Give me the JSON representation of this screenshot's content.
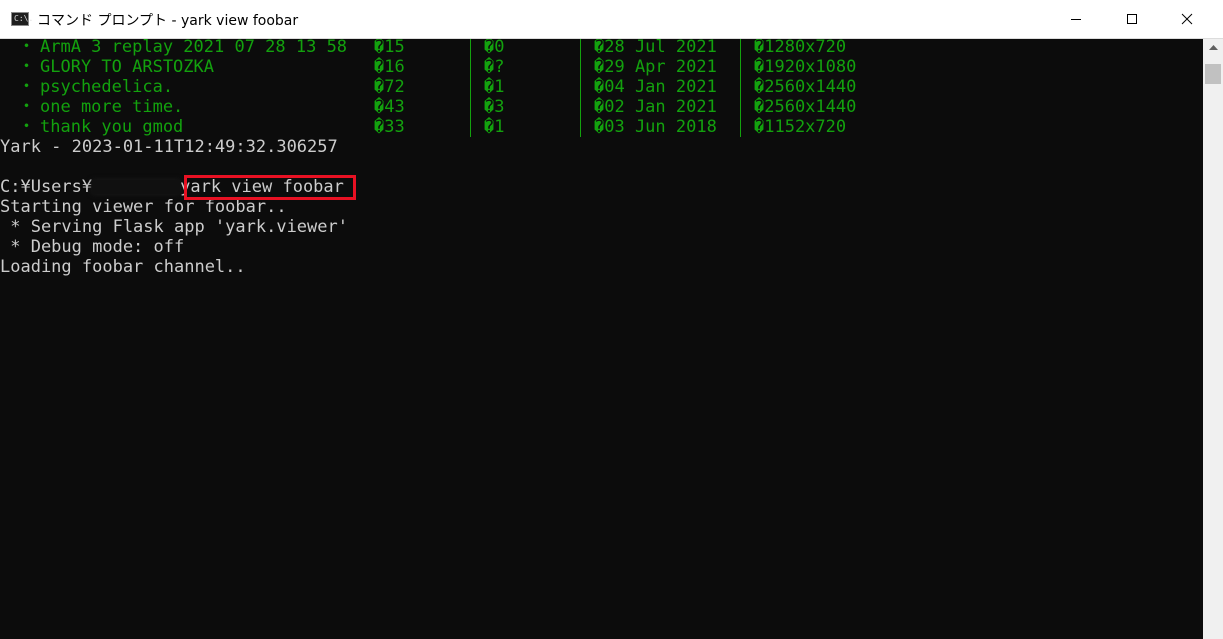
{
  "window": {
    "title": "コマンド プロンプト - yark  view foobar",
    "app_icon_text": "C:\\."
  },
  "table": {
    "rows": [
      {
        "bullet": "・",
        "name": "ArmA 3 replay 2021 07 28 13 58",
        "views": "�15",
        "likes": "�0",
        "date": "�28 Jul 2021",
        "resolution": "�1280x720"
      },
      {
        "bullet": "・",
        "name": "GLORY TO ARSTOZKA",
        "views": "�16",
        "likes": "�?",
        "date": "�29 Apr 2021",
        "resolution": "�1920x1080"
      },
      {
        "bullet": "・",
        "name": "psychedelica.",
        "views": "�72",
        "likes": "�1",
        "date": "�04 Jan 2021",
        "resolution": "�2560x1440"
      },
      {
        "bullet": "・",
        "name": "one more time.",
        "views": "�43",
        "likes": "�3",
        "date": "�02 Jan 2021",
        "resolution": "�2560x1440"
      },
      {
        "bullet": "・",
        "name": "thank you gmod",
        "views": "�33",
        "likes": "�1",
        "date": "�03 Jun 2018",
        "resolution": "�1152x720"
      }
    ]
  },
  "output": {
    "timestamp_line": "Yark - 2023-01-11T12:49:32.306257",
    "prompt_prefix": "C:¥Users¥",
    "command": "yark view foobar",
    "lines": [
      "Starting viewer for foobar..",
      " * Serving Flask app 'yark.viewer'",
      " * Debug mode: off",
      "Loading foobar channel.."
    ]
  },
  "icons": [
    "cmd-app-icon",
    "minimize-icon",
    "maximize-icon",
    "close-icon",
    "scroll-up-arrow-icon"
  ],
  "colors": {
    "console_bg": "#0c0c0c",
    "console_text": "#cccccc",
    "table_green": "#13a10e",
    "highlight_red": "#e81123"
  }
}
